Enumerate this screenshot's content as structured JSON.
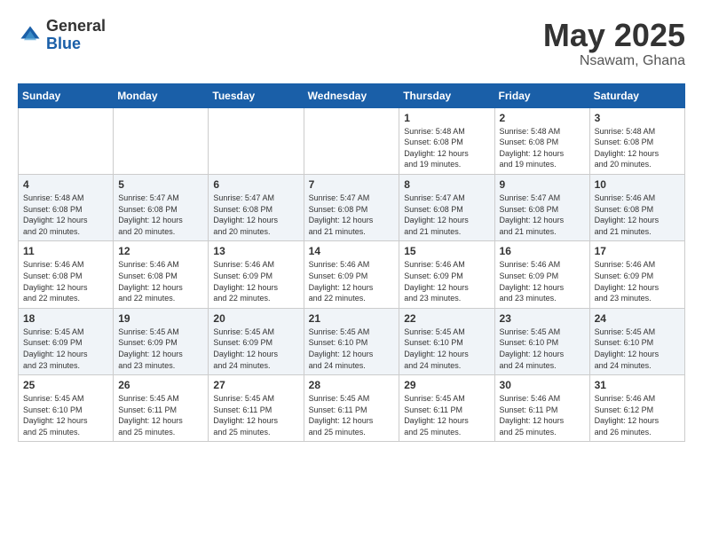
{
  "header": {
    "logo": {
      "general": "General",
      "blue": "Blue"
    },
    "title": "May 2025",
    "location": "Nsawam, Ghana"
  },
  "calendar": {
    "days_of_week": [
      "Sunday",
      "Monday",
      "Tuesday",
      "Wednesday",
      "Thursday",
      "Friday",
      "Saturday"
    ],
    "weeks": [
      {
        "days": [
          {
            "num": "",
            "info": ""
          },
          {
            "num": "",
            "info": ""
          },
          {
            "num": "",
            "info": ""
          },
          {
            "num": "",
            "info": ""
          },
          {
            "num": "1",
            "info": "Sunrise: 5:48 AM\nSunset: 6:08 PM\nDaylight: 12 hours\nand 19 minutes."
          },
          {
            "num": "2",
            "info": "Sunrise: 5:48 AM\nSunset: 6:08 PM\nDaylight: 12 hours\nand 19 minutes."
          },
          {
            "num": "3",
            "info": "Sunrise: 5:48 AM\nSunset: 6:08 PM\nDaylight: 12 hours\nand 20 minutes."
          }
        ]
      },
      {
        "days": [
          {
            "num": "4",
            "info": "Sunrise: 5:48 AM\nSunset: 6:08 PM\nDaylight: 12 hours\nand 20 minutes."
          },
          {
            "num": "5",
            "info": "Sunrise: 5:47 AM\nSunset: 6:08 PM\nDaylight: 12 hours\nand 20 minutes."
          },
          {
            "num": "6",
            "info": "Sunrise: 5:47 AM\nSunset: 6:08 PM\nDaylight: 12 hours\nand 20 minutes."
          },
          {
            "num": "7",
            "info": "Sunrise: 5:47 AM\nSunset: 6:08 PM\nDaylight: 12 hours\nand 21 minutes."
          },
          {
            "num": "8",
            "info": "Sunrise: 5:47 AM\nSunset: 6:08 PM\nDaylight: 12 hours\nand 21 minutes."
          },
          {
            "num": "9",
            "info": "Sunrise: 5:47 AM\nSunset: 6:08 PM\nDaylight: 12 hours\nand 21 minutes."
          },
          {
            "num": "10",
            "info": "Sunrise: 5:46 AM\nSunset: 6:08 PM\nDaylight: 12 hours\nand 21 minutes."
          }
        ]
      },
      {
        "days": [
          {
            "num": "11",
            "info": "Sunrise: 5:46 AM\nSunset: 6:08 PM\nDaylight: 12 hours\nand 22 minutes."
          },
          {
            "num": "12",
            "info": "Sunrise: 5:46 AM\nSunset: 6:08 PM\nDaylight: 12 hours\nand 22 minutes."
          },
          {
            "num": "13",
            "info": "Sunrise: 5:46 AM\nSunset: 6:09 PM\nDaylight: 12 hours\nand 22 minutes."
          },
          {
            "num": "14",
            "info": "Sunrise: 5:46 AM\nSunset: 6:09 PM\nDaylight: 12 hours\nand 22 minutes."
          },
          {
            "num": "15",
            "info": "Sunrise: 5:46 AM\nSunset: 6:09 PM\nDaylight: 12 hours\nand 23 minutes."
          },
          {
            "num": "16",
            "info": "Sunrise: 5:46 AM\nSunset: 6:09 PM\nDaylight: 12 hours\nand 23 minutes."
          },
          {
            "num": "17",
            "info": "Sunrise: 5:46 AM\nSunset: 6:09 PM\nDaylight: 12 hours\nand 23 minutes."
          }
        ]
      },
      {
        "days": [
          {
            "num": "18",
            "info": "Sunrise: 5:45 AM\nSunset: 6:09 PM\nDaylight: 12 hours\nand 23 minutes."
          },
          {
            "num": "19",
            "info": "Sunrise: 5:45 AM\nSunset: 6:09 PM\nDaylight: 12 hours\nand 23 minutes."
          },
          {
            "num": "20",
            "info": "Sunrise: 5:45 AM\nSunset: 6:09 PM\nDaylight: 12 hours\nand 24 minutes."
          },
          {
            "num": "21",
            "info": "Sunrise: 5:45 AM\nSunset: 6:10 PM\nDaylight: 12 hours\nand 24 minutes."
          },
          {
            "num": "22",
            "info": "Sunrise: 5:45 AM\nSunset: 6:10 PM\nDaylight: 12 hours\nand 24 minutes."
          },
          {
            "num": "23",
            "info": "Sunrise: 5:45 AM\nSunset: 6:10 PM\nDaylight: 12 hours\nand 24 minutes."
          },
          {
            "num": "24",
            "info": "Sunrise: 5:45 AM\nSunset: 6:10 PM\nDaylight: 12 hours\nand 24 minutes."
          }
        ]
      },
      {
        "days": [
          {
            "num": "25",
            "info": "Sunrise: 5:45 AM\nSunset: 6:10 PM\nDaylight: 12 hours\nand 25 minutes."
          },
          {
            "num": "26",
            "info": "Sunrise: 5:45 AM\nSunset: 6:11 PM\nDaylight: 12 hours\nand 25 minutes."
          },
          {
            "num": "27",
            "info": "Sunrise: 5:45 AM\nSunset: 6:11 PM\nDaylight: 12 hours\nand 25 minutes."
          },
          {
            "num": "28",
            "info": "Sunrise: 5:45 AM\nSunset: 6:11 PM\nDaylight: 12 hours\nand 25 minutes."
          },
          {
            "num": "29",
            "info": "Sunrise: 5:45 AM\nSunset: 6:11 PM\nDaylight: 12 hours\nand 25 minutes."
          },
          {
            "num": "30",
            "info": "Sunrise: 5:46 AM\nSunset: 6:11 PM\nDaylight: 12 hours\nand 25 minutes."
          },
          {
            "num": "31",
            "info": "Sunrise: 5:46 AM\nSunset: 6:12 PM\nDaylight: 12 hours\nand 26 minutes."
          }
        ]
      }
    ]
  }
}
